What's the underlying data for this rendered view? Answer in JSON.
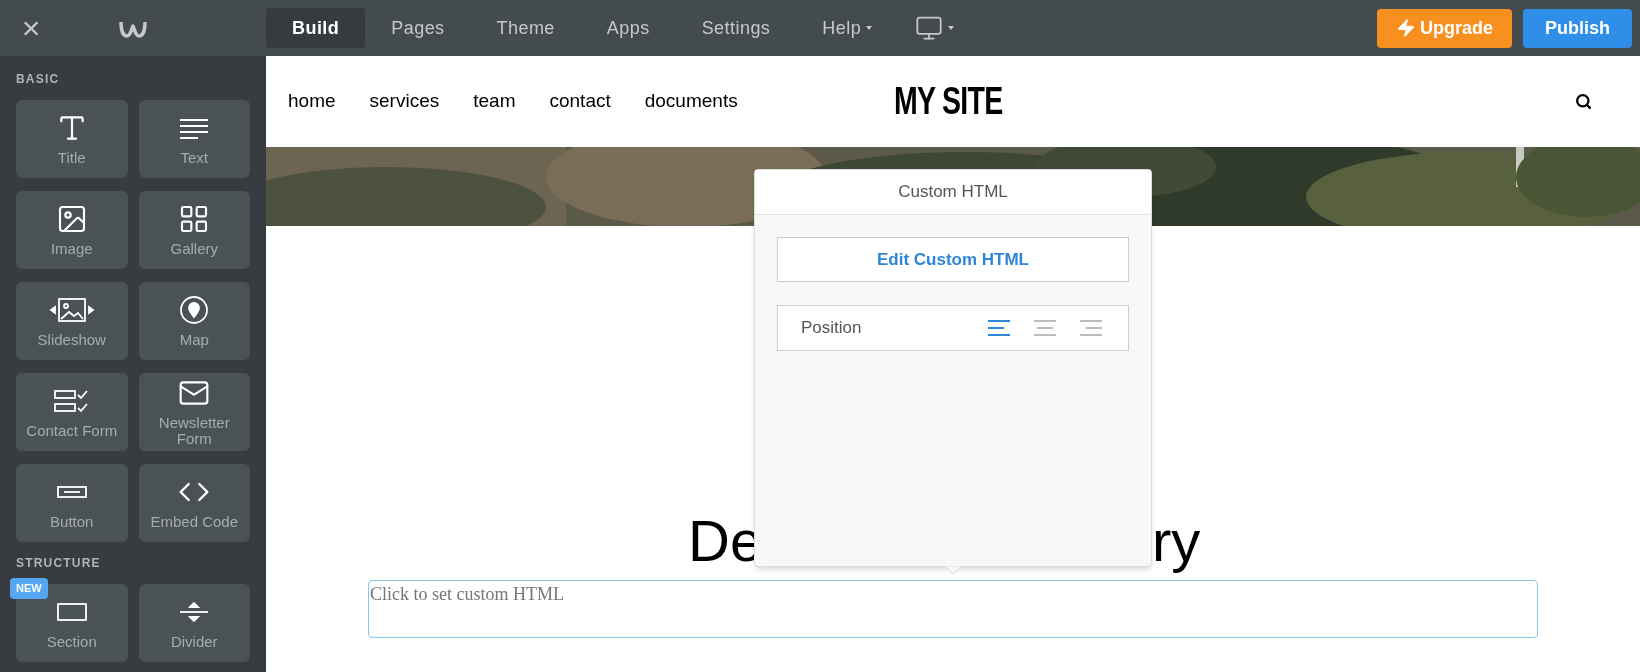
{
  "topbar": {
    "close": "×",
    "tabs": [
      {
        "label": "Build",
        "selected": true
      },
      {
        "label": "Pages",
        "selected": false
      },
      {
        "label": "Theme",
        "selected": false
      },
      {
        "label": "Apps",
        "selected": false
      },
      {
        "label": "Settings",
        "selected": false
      },
      {
        "label": "Help",
        "selected": false
      }
    ],
    "upgrade": "Upgrade",
    "publish": "Publish"
  },
  "sidebar": {
    "sections": [
      {
        "title": "BASIC",
        "items": [
          {
            "label": "Title"
          },
          {
            "label": "Text"
          },
          {
            "label": "Image"
          },
          {
            "label": "Gallery"
          },
          {
            "label": "Slideshow"
          },
          {
            "label": "Map"
          },
          {
            "label": "Contact Form"
          },
          {
            "label": "Newsletter Form"
          },
          {
            "label": "Button"
          },
          {
            "label": "Embed Code"
          }
        ]
      },
      {
        "title": "STRUCTURE",
        "items": [
          {
            "label": "Section",
            "badge": "NEW"
          },
          {
            "label": "Divider"
          }
        ]
      }
    ]
  },
  "site": {
    "nav": [
      "home",
      "services",
      "team",
      "contact",
      "documents"
    ],
    "logo": "MY SITE",
    "heading_left": "De",
    "heading_right": "ry",
    "custom_html_placeholder": "Click to set custom HTML"
  },
  "popup": {
    "title": "Custom HTML",
    "edit_button": "Edit Custom HTML",
    "position_label": "Position",
    "alignments": [
      {
        "kind": "left",
        "selected": true
      },
      {
        "kind": "center",
        "selected": false
      },
      {
        "kind": "right",
        "selected": false
      }
    ]
  }
}
